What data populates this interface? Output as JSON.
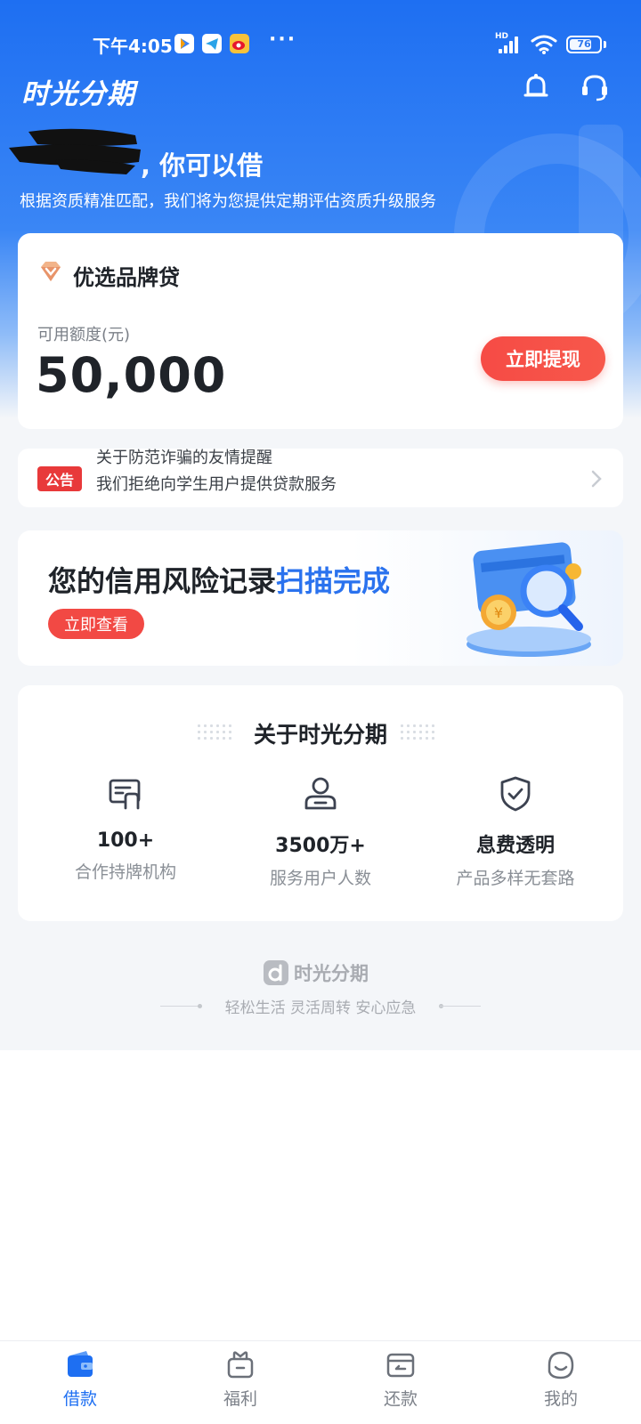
{
  "status_bar": {
    "time": "下午4:05",
    "more": "···",
    "network": "HD",
    "battery": "76",
    "battery_level": 0.76
  },
  "header": {
    "app_name": "时光分期",
    "greeting": "你可以借",
    "subtitle": "根据资质精准匹配，我们将为您提供定期评估资质升级服务"
  },
  "loan_card": {
    "title": "优选品牌贷",
    "limit_label": "可用额度(元)",
    "limit_amount": "50,000",
    "withdraw_label": "立即提现"
  },
  "notice": {
    "badge": "公告",
    "line1": "关于防范诈骗的友情提醒",
    "line2": "我们拒绝向学生用户提供贷款服务"
  },
  "credit_banner": {
    "title_prefix": "您的信用风险记录",
    "title_highlight": "扫描完成",
    "button_label": "立即查看"
  },
  "about": {
    "title": "关于时光分期",
    "features": [
      {
        "value": "100+",
        "desc": "合作持牌机构",
        "icon": "license-icon"
      },
      {
        "value": "3500万+",
        "desc": "服务用户人数",
        "icon": "user-icon"
      },
      {
        "value": "息费透明",
        "desc": "产品多样无套路",
        "icon": "shield-check-icon"
      }
    ]
  },
  "footer": {
    "brand": "时光分期",
    "slogan": "轻松生活 灵活周转 安心应急"
  },
  "nav": {
    "items": [
      {
        "label": "借款",
        "icon": "wallet-icon",
        "active": true
      },
      {
        "label": "福利",
        "icon": "gift-icon",
        "active": false
      },
      {
        "label": "还款",
        "icon": "repay-icon",
        "active": false
      },
      {
        "label": "我的",
        "icon": "profile-icon",
        "active": false
      }
    ]
  },
  "colors": {
    "brand_blue": "#1e6ff2",
    "accent_red": "#f64b45",
    "highlight_blue": "#2a72ee"
  }
}
